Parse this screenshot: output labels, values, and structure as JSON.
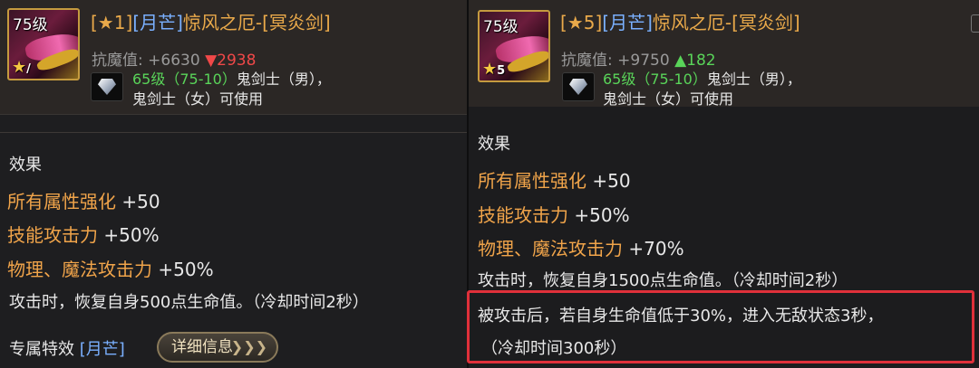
{
  "left": {
    "icon": {
      "level": "75级",
      "star": "★",
      "star_num": "/"
    },
    "title": {
      "star": "[★1]",
      "tag": "[月芒]",
      "name": "惊风之厄-[冥炎剑]"
    },
    "stat": {
      "label": "抗魔值: ",
      "value": "+6630 ",
      "delta_arrow": "▼",
      "delta": "2938"
    },
    "requirement": {
      "level": "65级（75-10）",
      "class1": "鬼剑士（男），",
      "class2": "鬼剑士（女）可使用"
    },
    "effects_title": "效果",
    "effects": [
      {
        "label": "所有属性强化 ",
        "value": "+50"
      },
      {
        "label": "技能攻击力 ",
        "value": "+50%"
      },
      {
        "label": "物理、魔法攻击力 ",
        "value": "+50%"
      }
    ],
    "note": "攻击时，恢复自身500点生命值。（冷却时间2秒）",
    "exclusive": {
      "label": "专属特效 ",
      "tag": "[月芒]"
    },
    "detail_button": {
      "label": "详细信息",
      "arrows": "❯❯❯"
    }
  },
  "right": {
    "icon": {
      "level": "75级",
      "star": "★",
      "star_num": "5"
    },
    "title": {
      "star": "[★5]",
      "tag": "[月芒]",
      "name": "惊风之厄-[冥炎剑]"
    },
    "stat": {
      "label": "抗魔值: ",
      "value": "+9750 ",
      "delta_arrow": "▲",
      "delta": "182"
    },
    "requirement": {
      "level": "65级（75-10）",
      "class1": "鬼剑士（男），",
      "class2": "鬼剑士（女）可使用"
    },
    "effects_title": "效果",
    "effects": [
      {
        "label": "所有属性强化 ",
        "value": "+50"
      },
      {
        "label": "技能攻击力 ",
        "value": "+50%"
      },
      {
        "label": "物理、魔法攻击力 ",
        "value": "+70%"
      }
    ],
    "note": "攻击时，恢复自身1500点生命值。（冷却时间2秒）",
    "highlight_line1": "被攻击后，若自身生命值低于30%，进入无敌状态3秒，",
    "highlight_line2": "（冷却时间300秒）"
  },
  "colors": {
    "label_orange": "#f0a44a",
    "tag_blue": "#7ab0ff",
    "up_green": "#59d459",
    "down_red": "#f04848",
    "highlight_red": "#e0303a"
  }
}
